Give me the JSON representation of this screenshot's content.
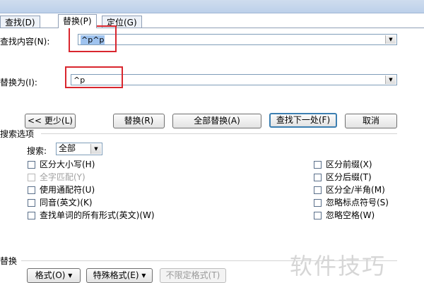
{
  "tabs": [
    {
      "label": "查找(D)"
    },
    {
      "label": "替换(P)"
    },
    {
      "label": "定位(G)"
    }
  ],
  "find": {
    "label": "查找内容(N):",
    "value": "^p^p"
  },
  "replace": {
    "label": "替换为(I):",
    "value": "^p"
  },
  "buttons": {
    "less": "<< 更少(L)",
    "replace": "替换(R)",
    "replace_all": "全部替换(A)",
    "find_next": "查找下一处(F)",
    "cancel": "取消"
  },
  "options": {
    "section_title": "搜索选项",
    "search_label": "搜索:",
    "search_value": "全部",
    "left_checks": [
      {
        "label": "区分大小写(H)",
        "enabled": true
      },
      {
        "label": "全字匹配(Y)",
        "enabled": false
      },
      {
        "label": "使用通配符(U)",
        "enabled": true
      },
      {
        "label": "同音(英文)(K)",
        "enabled": true
      },
      {
        "label": "查找单词的所有形式(英文)(W)",
        "enabled": true
      }
    ],
    "right_checks": [
      {
        "label": "区分前缀(X)"
      },
      {
        "label": "区分后缀(T)"
      },
      {
        "label": "区分全/半角(M)"
      },
      {
        "label": "忽略标点符号(S)"
      },
      {
        "label": "忽略空格(W)"
      }
    ]
  },
  "replace_section": {
    "title": "替换",
    "format_button": "格式(O) ▾",
    "special_button": "特殊格式(E) ▾",
    "no_format_button": "不限定格式(T)"
  },
  "watermark": "软件技巧",
  "colors": {
    "highlight_box": "#d9262e",
    "selection": "#9fc3ef",
    "focus_border": "#3c7fb1"
  }
}
